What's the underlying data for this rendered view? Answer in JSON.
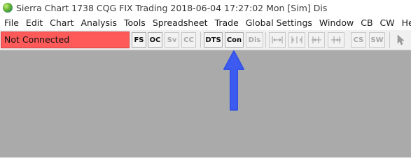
{
  "window": {
    "title": "Sierra Chart 1738 CQG FIX Trading 2018-06-04  17:27:02 Mon [Sim]  Dis"
  },
  "menu": {
    "items": [
      "File",
      "Edit",
      "Chart",
      "Analysis",
      "Tools",
      "Spreadsheet",
      "Trade",
      "Global Settings",
      "Window",
      "CB",
      "CW",
      "Help"
    ]
  },
  "toolbar": {
    "status_text": "Not Connected",
    "status_color": "#ff5a5a",
    "buttons": {
      "fs": "FS",
      "oc": "OC",
      "sv": "Sv",
      "cc": "CC",
      "dts": "DTS",
      "con": "Con",
      "dis": "Dis",
      "cs": "CS",
      "sw": "SW"
    },
    "icon_buttons": [
      "scale-left-right-icon",
      "scale-expand-icon",
      "scale-shift-left-icon",
      "scale-shift-right-icon",
      "pointer-icon"
    ]
  },
  "annotation": {
    "arrow_color": "#3d5bf0",
    "arrow_target": "Con"
  },
  "workspace": {
    "background": "#aaaaaa"
  }
}
